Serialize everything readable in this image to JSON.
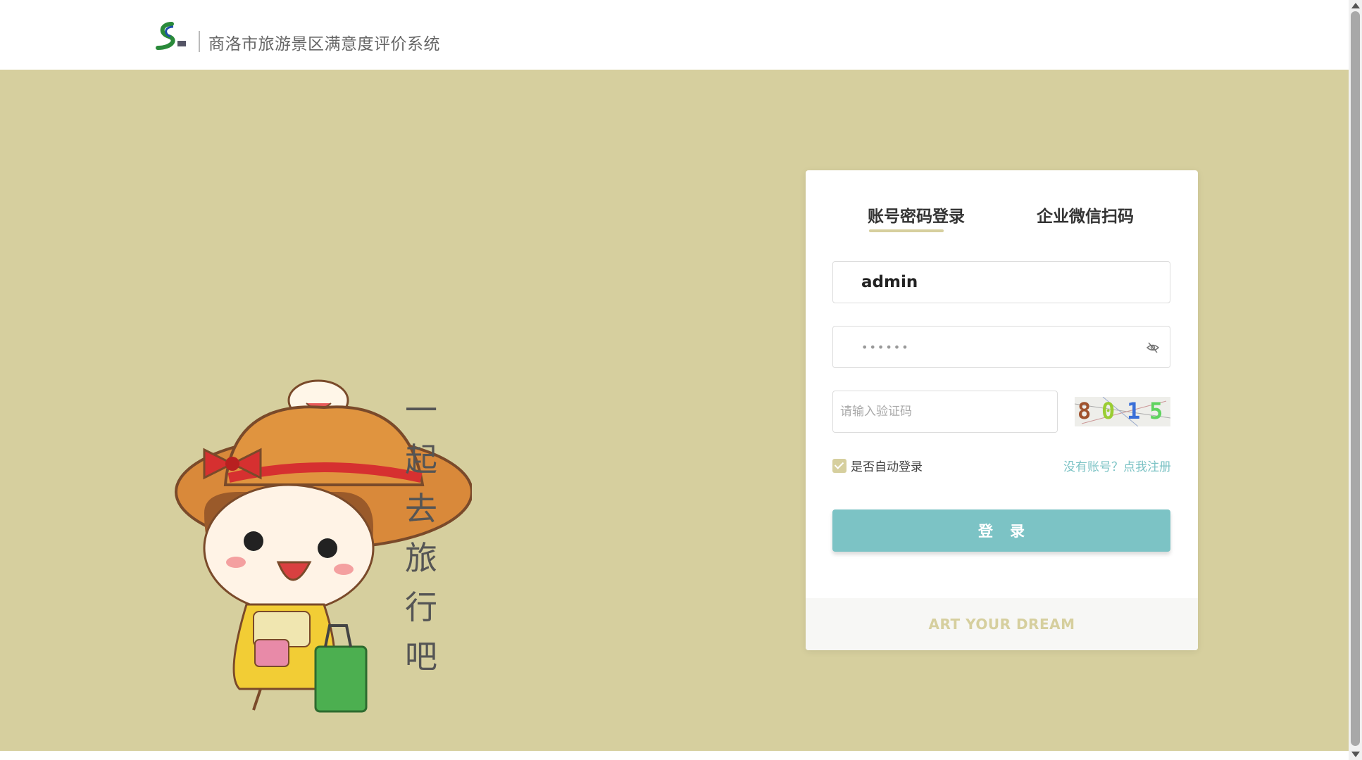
{
  "header": {
    "app_title": "商洛市旅游景区满意度评价系统",
    "logo_icon": "shangluo-s-logo"
  },
  "illustration": {
    "slogan": "一起去旅行吧",
    "icon": "girl-with-hat-suitcase-illustration"
  },
  "login": {
    "tabs": [
      {
        "label": "账号密码登录",
        "active": true
      },
      {
        "label": "企业微信扫码",
        "active": false
      }
    ],
    "username": {
      "value": "admin"
    },
    "password": {
      "masked_value": "••••••",
      "toggle_icon": "eye-slash-icon"
    },
    "captcha": {
      "placeholder": "请输入验证码",
      "code": [
        "8",
        "0",
        "1",
        "5"
      ],
      "code_colors": [
        "#a0522d",
        "#9acd32",
        "#3a6fd8",
        "#5fd35f"
      ]
    },
    "auto_login": {
      "label": "是否自动登录",
      "checked": true
    },
    "register_link": "没有账号？点我注册",
    "submit_label": "登录",
    "footer": "ART YOUR DREAM"
  },
  "colors": {
    "accent_beige": "#d6cf9e",
    "button_teal": "#7cc3c5",
    "link_teal": "#7cc3c5"
  }
}
